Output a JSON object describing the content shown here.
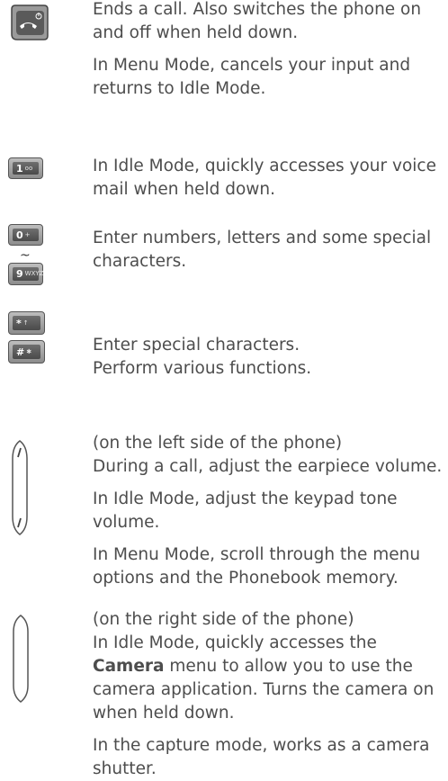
{
  "items": [
    {
      "icon": "end-key-icon",
      "paragraphs": [
        "Ends a call. Also switches the phone on and off when held down.",
        "In Menu Mode, cancels your input and returns to Idle Mode."
      ]
    },
    {
      "icon": "key-1-icon",
      "key_label": "1",
      "key_sub": "oo",
      "paragraphs": [
        "In Idle Mode, quickly accesses your voice mail when held down."
      ]
    },
    {
      "icon": "number-keys-icon",
      "key_label_top": "0",
      "key_sub_top": "+",
      "key_label_bottom": "9",
      "key_sub_bottom": "WXYZ",
      "paragraphs": [
        "Enter numbers, letters and some special characters."
      ]
    },
    {
      "icon": "star-hash-keys-icon",
      "key_label_top": "*",
      "key_sub_top": "↑",
      "key_label_bottom": "#",
      "key_sub_bottom": "✱",
      "paragraphs": [
        "Enter special characters.",
        "Perform various functions."
      ]
    },
    {
      "icon": "volume-key-icon",
      "paragraphs": [
        "(on the left side of the phone)",
        "During a call, adjust the earpiece volume.",
        "In Idle Mode, adjust the keypad tone volume.",
        "In Menu Mode, scroll through the menu options and the Phonebook memory."
      ]
    },
    {
      "icon": "camera-key-icon",
      "paragraphs": [
        "(on the right side of the phone)",
        "In Idle Mode, quickly accesses the",
        "menu to allow you to use the camera application. Turns the camera on when held down.",
        "In the capture mode, works as a camera shutter."
      ],
      "bold_word": "Camera"
    }
  ]
}
